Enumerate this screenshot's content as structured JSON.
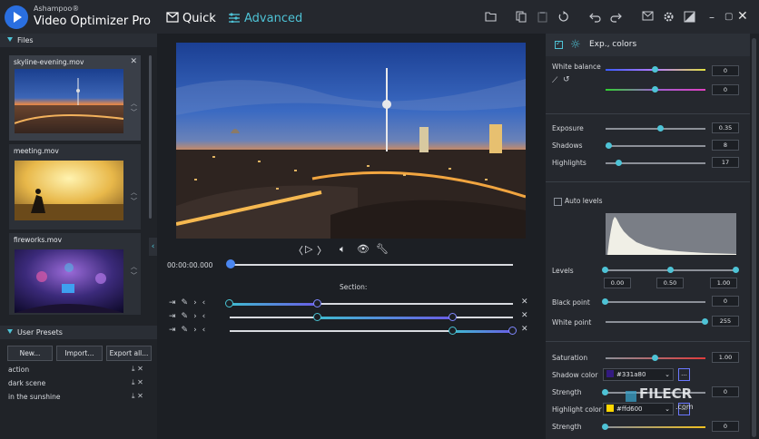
{
  "app": {
    "brand": "Ashampoo®",
    "name": "Video Optimizer Pro",
    "modes": {
      "quick": "Quick",
      "advanced": "Advanced"
    }
  },
  "toolbar_icons": [
    "folder-icon",
    "copy-icon",
    "clipboard-icon",
    "reset-icon",
    "undo-icon",
    "redo-icon",
    "mail-icon",
    "settings-icon",
    "compare-icon"
  ],
  "window": {
    "minimize": "–",
    "maximize": "▢",
    "close": "✕"
  },
  "files": {
    "header": "Files",
    "items": [
      {
        "name": "skyline-evening.mov"
      },
      {
        "name": "meeting.mov"
      },
      {
        "name": "fireworks.mov"
      }
    ]
  },
  "presets": {
    "header": "User Presets",
    "buttons": {
      "new": "New...",
      "import": "Import...",
      "export": "Export all..."
    },
    "items": [
      "action",
      "dark scene",
      "in the sunshine"
    ]
  },
  "player": {
    "timecode": "00:00:00.000",
    "position": 0.0,
    "section_label": "Section:",
    "sections": [
      {
        "start": 0.0,
        "end": 0.31
      },
      {
        "start": 0.31,
        "end": 0.79
      },
      {
        "start": 0.79,
        "end": 1.0
      }
    ]
  },
  "panel": {
    "title": "Exp., colors",
    "white_balance": {
      "label": "White balance",
      "value1": "0",
      "value2": "0"
    },
    "exposure": {
      "label": "Exposure",
      "value": "0.35",
      "level": 0.55
    },
    "shadows": {
      "label": "Shadows",
      "value": "8",
      "level": 0.04
    },
    "highlights": {
      "label": "Highlights",
      "value": "17",
      "level": 0.14
    },
    "auto_levels": {
      "label": "Auto levels",
      "checked": false
    },
    "levels": {
      "label": "Levels",
      "low": "0.00",
      "mid": "0.50",
      "high": "1.00"
    },
    "black_point": {
      "label": "Black point",
      "value": "0",
      "level": 0.0
    },
    "white_point": {
      "label": "White point",
      "value": "255",
      "level": 1.0
    },
    "saturation": {
      "label": "Saturation",
      "value": "1.00",
      "level": 0.5
    },
    "shadow_color": {
      "label": "Shadow color",
      "hex": "#331a80",
      "swatch": "#331a80"
    },
    "strength1": {
      "label": "Strength",
      "value": "0"
    },
    "highlight_color": {
      "label": "Highlight color",
      "hex": "#ffd600",
      "swatch": "#ffd600"
    },
    "strength2": {
      "label": "Strength",
      "value": "0"
    }
  },
  "watermark": {
    "brand": "FILECR",
    "suffix": ".com"
  },
  "colors": {
    "accent": "#4ec3d6",
    "accent_blue": "#4a86f0"
  }
}
